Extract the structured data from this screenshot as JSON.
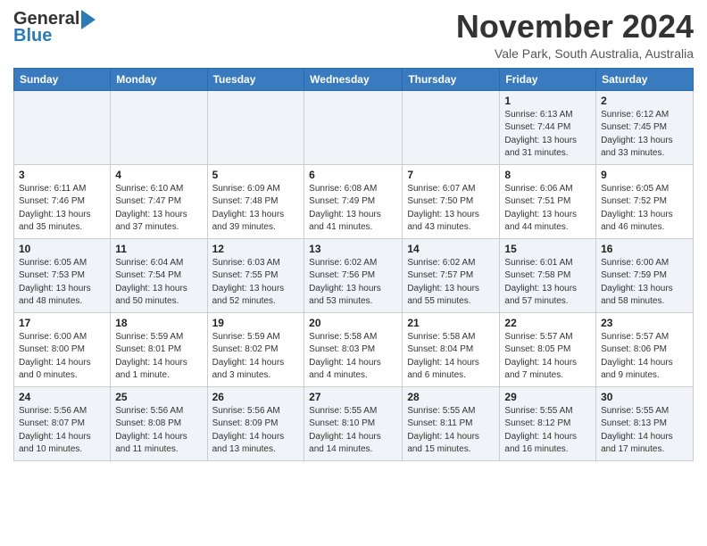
{
  "header": {
    "logo_line1": "General",
    "logo_line2": "Blue",
    "month": "November 2024",
    "location": "Vale Park, South Australia, Australia"
  },
  "days_of_week": [
    "Sunday",
    "Monday",
    "Tuesday",
    "Wednesday",
    "Thursday",
    "Friday",
    "Saturday"
  ],
  "weeks": [
    [
      {
        "day": "",
        "info": ""
      },
      {
        "day": "",
        "info": ""
      },
      {
        "day": "",
        "info": ""
      },
      {
        "day": "",
        "info": ""
      },
      {
        "day": "",
        "info": ""
      },
      {
        "day": "1",
        "info": "Sunrise: 6:13 AM\nSunset: 7:44 PM\nDaylight: 13 hours\nand 31 minutes."
      },
      {
        "day": "2",
        "info": "Sunrise: 6:12 AM\nSunset: 7:45 PM\nDaylight: 13 hours\nand 33 minutes."
      }
    ],
    [
      {
        "day": "3",
        "info": "Sunrise: 6:11 AM\nSunset: 7:46 PM\nDaylight: 13 hours\nand 35 minutes."
      },
      {
        "day": "4",
        "info": "Sunrise: 6:10 AM\nSunset: 7:47 PM\nDaylight: 13 hours\nand 37 minutes."
      },
      {
        "day": "5",
        "info": "Sunrise: 6:09 AM\nSunset: 7:48 PM\nDaylight: 13 hours\nand 39 minutes."
      },
      {
        "day": "6",
        "info": "Sunrise: 6:08 AM\nSunset: 7:49 PM\nDaylight: 13 hours\nand 41 minutes."
      },
      {
        "day": "7",
        "info": "Sunrise: 6:07 AM\nSunset: 7:50 PM\nDaylight: 13 hours\nand 43 minutes."
      },
      {
        "day": "8",
        "info": "Sunrise: 6:06 AM\nSunset: 7:51 PM\nDaylight: 13 hours\nand 44 minutes."
      },
      {
        "day": "9",
        "info": "Sunrise: 6:05 AM\nSunset: 7:52 PM\nDaylight: 13 hours\nand 46 minutes."
      }
    ],
    [
      {
        "day": "10",
        "info": "Sunrise: 6:05 AM\nSunset: 7:53 PM\nDaylight: 13 hours\nand 48 minutes."
      },
      {
        "day": "11",
        "info": "Sunrise: 6:04 AM\nSunset: 7:54 PM\nDaylight: 13 hours\nand 50 minutes."
      },
      {
        "day": "12",
        "info": "Sunrise: 6:03 AM\nSunset: 7:55 PM\nDaylight: 13 hours\nand 52 minutes."
      },
      {
        "day": "13",
        "info": "Sunrise: 6:02 AM\nSunset: 7:56 PM\nDaylight: 13 hours\nand 53 minutes."
      },
      {
        "day": "14",
        "info": "Sunrise: 6:02 AM\nSunset: 7:57 PM\nDaylight: 13 hours\nand 55 minutes."
      },
      {
        "day": "15",
        "info": "Sunrise: 6:01 AM\nSunset: 7:58 PM\nDaylight: 13 hours\nand 57 minutes."
      },
      {
        "day": "16",
        "info": "Sunrise: 6:00 AM\nSunset: 7:59 PM\nDaylight: 13 hours\nand 58 minutes."
      }
    ],
    [
      {
        "day": "17",
        "info": "Sunrise: 6:00 AM\nSunset: 8:00 PM\nDaylight: 14 hours\nand 0 minutes."
      },
      {
        "day": "18",
        "info": "Sunrise: 5:59 AM\nSunset: 8:01 PM\nDaylight: 14 hours\nand 1 minute."
      },
      {
        "day": "19",
        "info": "Sunrise: 5:59 AM\nSunset: 8:02 PM\nDaylight: 14 hours\nand 3 minutes."
      },
      {
        "day": "20",
        "info": "Sunrise: 5:58 AM\nSunset: 8:03 PM\nDaylight: 14 hours\nand 4 minutes."
      },
      {
        "day": "21",
        "info": "Sunrise: 5:58 AM\nSunset: 8:04 PM\nDaylight: 14 hours\nand 6 minutes."
      },
      {
        "day": "22",
        "info": "Sunrise: 5:57 AM\nSunset: 8:05 PM\nDaylight: 14 hours\nand 7 minutes."
      },
      {
        "day": "23",
        "info": "Sunrise: 5:57 AM\nSunset: 8:06 PM\nDaylight: 14 hours\nand 9 minutes."
      }
    ],
    [
      {
        "day": "24",
        "info": "Sunrise: 5:56 AM\nSunset: 8:07 PM\nDaylight: 14 hours\nand 10 minutes."
      },
      {
        "day": "25",
        "info": "Sunrise: 5:56 AM\nSunset: 8:08 PM\nDaylight: 14 hours\nand 11 minutes."
      },
      {
        "day": "26",
        "info": "Sunrise: 5:56 AM\nSunset: 8:09 PM\nDaylight: 14 hours\nand 13 minutes."
      },
      {
        "day": "27",
        "info": "Sunrise: 5:55 AM\nSunset: 8:10 PM\nDaylight: 14 hours\nand 14 minutes."
      },
      {
        "day": "28",
        "info": "Sunrise: 5:55 AM\nSunset: 8:11 PM\nDaylight: 14 hours\nand 15 minutes."
      },
      {
        "day": "29",
        "info": "Sunrise: 5:55 AM\nSunset: 8:12 PM\nDaylight: 14 hours\nand 16 minutes."
      },
      {
        "day": "30",
        "info": "Sunrise: 5:55 AM\nSunset: 8:13 PM\nDaylight: 14 hours\nand 17 minutes."
      }
    ]
  ]
}
